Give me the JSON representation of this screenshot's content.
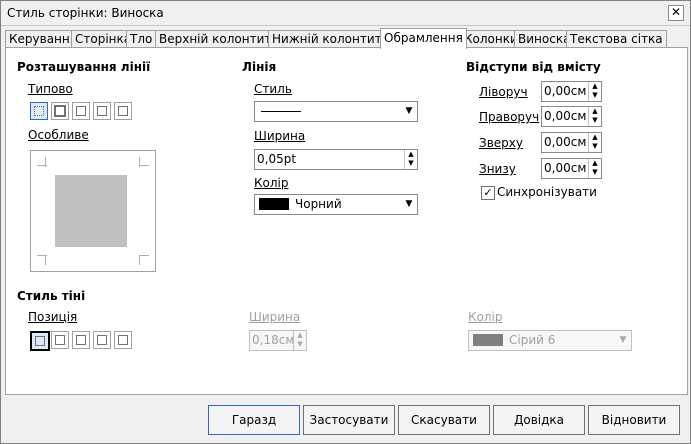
{
  "window": {
    "title": "Стиль сторінки: Виноска"
  },
  "tabs": [
    {
      "label": "Керування"
    },
    {
      "label": "Сторінка"
    },
    {
      "label": "Тло"
    },
    {
      "label": "Верхній колонтитул"
    },
    {
      "label": "Нижній колонтитул"
    },
    {
      "label": "Обрамлення"
    },
    {
      "label": "Колонки"
    },
    {
      "label": "Виноска"
    },
    {
      "label": "Текстова сітка"
    }
  ],
  "line_arrangement": {
    "title": "Розташування лінії",
    "default_label": "Типово",
    "custom_label": "Особливе"
  },
  "line": {
    "title": "Лінія",
    "style_label": "Стиль",
    "width_label": "Ширина",
    "width_value": "0,05pt",
    "color_label": "Колір",
    "color_value": "Чорний",
    "color_hex": "#000000"
  },
  "spacing": {
    "title": "Відступи від вмісту",
    "left_label": "Ліворуч",
    "left_value": "0,00см",
    "right_label": "Праворуч",
    "right_value": "0,00см",
    "top_label": "Зверху",
    "top_value": "0,00см",
    "bottom_label": "Знизу",
    "bottom_value": "0,00см",
    "sync_label": "Синхронізувати",
    "sync_checked": true
  },
  "shadow": {
    "title": "Стиль тіні",
    "position_label": "Позиція",
    "width_label": "Ширина",
    "width_value": "0,18см",
    "color_label": "Колір",
    "color_value": "Сірий 6",
    "color_hex": "#808080"
  },
  "buttons": {
    "ok": "Гаразд",
    "apply": "Застосувати",
    "cancel": "Скасувати",
    "help": "Довідка",
    "reset": "Відновити"
  }
}
